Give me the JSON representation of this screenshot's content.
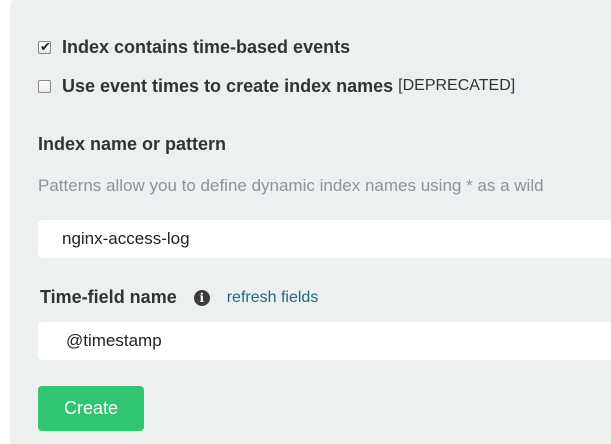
{
  "options": {
    "time_based": {
      "label": "Index contains time-based events",
      "checked": true
    },
    "event_times": {
      "label": "Use event times to create index names",
      "suffix": "[DEPRECATED]",
      "checked": false
    }
  },
  "index_pattern": {
    "label": "Index name or pattern",
    "help": "Patterns allow you to define dynamic index names using * as a wild",
    "value": "nginx-access-log"
  },
  "time_field": {
    "label": "Time-field name",
    "info_icon": "info-circle-icon",
    "refresh_label": "refresh fields",
    "value": "@timestamp"
  },
  "actions": {
    "create_label": "Create"
  },
  "colors": {
    "panel_bg": "#ecf0f1",
    "create_button": "#31c471",
    "link": "#1f6b7a"
  }
}
